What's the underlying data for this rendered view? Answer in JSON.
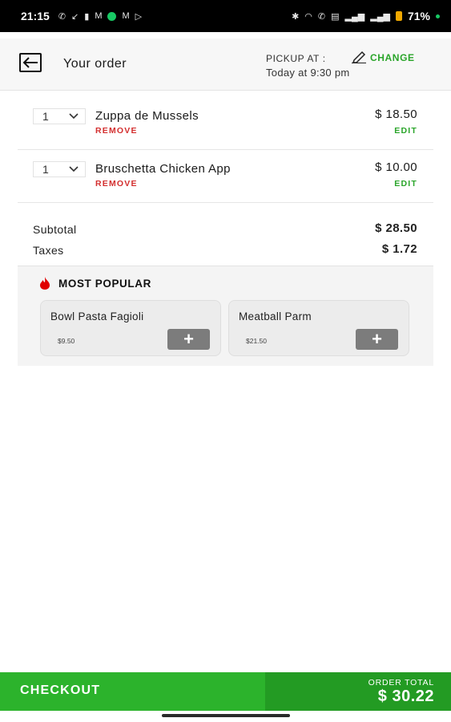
{
  "status_bar": {
    "time": "21:15",
    "battery": "71%",
    "left_icons": [
      "phone-icon",
      "missed-call-icon",
      "notification-icon",
      "mail-icon",
      "location-icon",
      "mail-icon",
      "play-icon"
    ],
    "right_icons": [
      "bluetooth-icon",
      "wifi-icon",
      "call-icon",
      "volte-icon",
      "signal-icon",
      "signal-icon"
    ],
    "accent_color": "#18c964"
  },
  "header": {
    "title": "Your order",
    "pickup_label": "PICKUP AT :",
    "change_label": "CHANGE",
    "pickup_time": "Today at 9:30 pm"
  },
  "order": {
    "items": [
      {
        "qty": "1",
        "name": "Zuppa de Mussels",
        "price": "$ 18.50",
        "remove_label": "REMOVE",
        "edit_label": "EDIT"
      },
      {
        "qty": "1",
        "name": "Bruschetta Chicken App",
        "price": "$ 10.00",
        "remove_label": "REMOVE",
        "edit_label": "EDIT"
      }
    ]
  },
  "totals": {
    "subtotal_label": "Subtotal",
    "subtotal_value": "$ 28.50",
    "taxes_label": "Taxes",
    "taxes_value": "$ 1.72"
  },
  "popular": {
    "title": "MOST POPULAR",
    "items": [
      {
        "name": "Bowl Pasta Fagioli",
        "price": "$9.50",
        "add_label": "+"
      },
      {
        "name": "Meatball Parm",
        "price": "$21.50",
        "add_label": "+"
      }
    ]
  },
  "checkout": {
    "label": "CHECKOUT",
    "total_caption": "ORDER TOTAL",
    "total_value": "$ 30.22"
  },
  "colors": {
    "brand_green": "#2cb32c",
    "brand_green_dark": "#239b23",
    "remove_red": "#d32f2f",
    "edit_green": "#2aa52a"
  }
}
